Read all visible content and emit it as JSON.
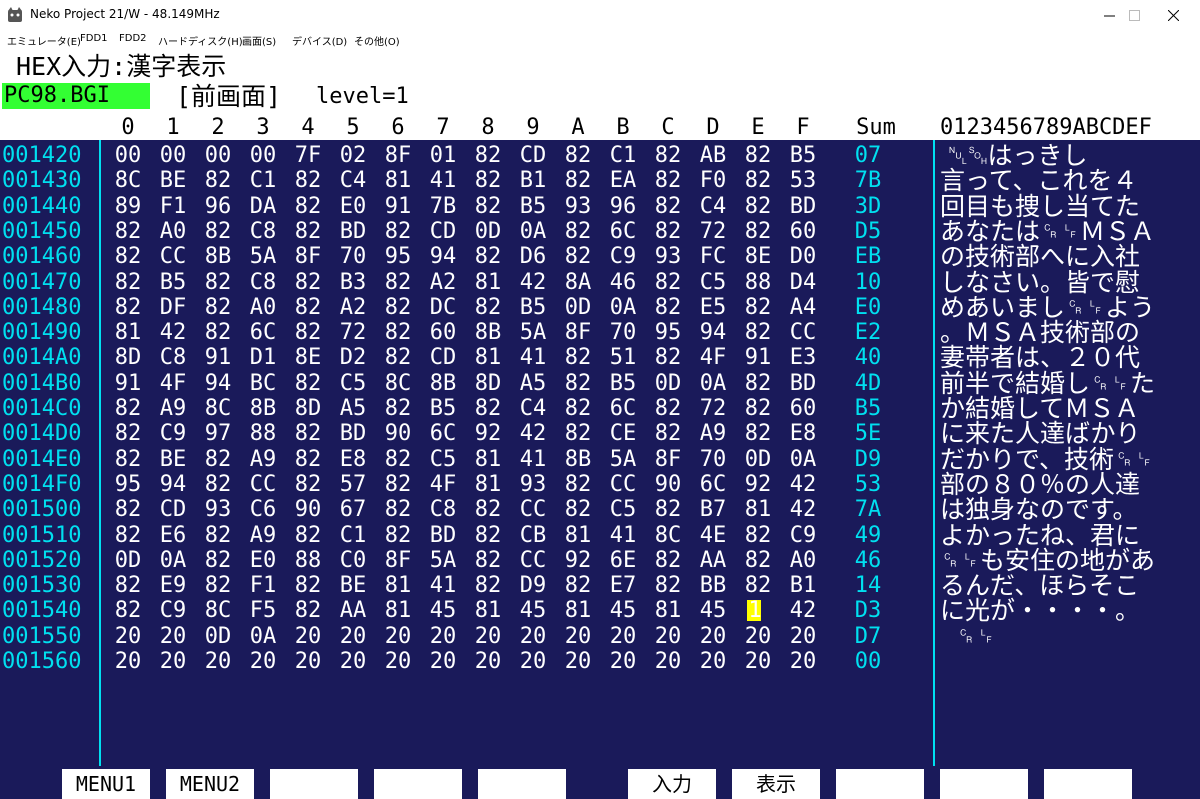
{
  "window": {
    "title": "Neko Project 21/W - 48.149MHz",
    "minimize_icon": "minimize-icon",
    "maximize_icon": "maximize-icon",
    "close_icon": "close-icon"
  },
  "menu": [
    "エミュレータ(E)",
    "FDD1",
    "FDD2",
    "ハードディスク(H)",
    "画面(S)",
    "デバイス(D)",
    "その他(O)"
  ],
  "header": {
    "mode_line": "HEX入力:漢字表示",
    "filename": "PC98.BGI",
    "display_mode": "[前画面]",
    "level": "level=1"
  },
  "columns": {
    "hex": [
      "0",
      "1",
      "2",
      "3",
      "4",
      "5",
      "6",
      "7",
      "8",
      "9",
      "A",
      "B",
      "C",
      "D",
      "E",
      "F"
    ],
    "sum_label": "Sum",
    "text_label": "0123456789ABCDEF"
  },
  "rows": [
    {
      "addr": "001420",
      "bytes": [
        "00",
        "00",
        "00",
        "00",
        "7F",
        "02",
        "8F",
        "01",
        "82",
        "CD",
        "82",
        "C1",
        "82",
        "AB",
        "82",
        "B5"
      ],
      "sum": "07"
    },
    {
      "addr": "001430",
      "bytes": [
        "8C",
        "BE",
        "82",
        "C1",
        "82",
        "C4",
        "81",
        "41",
        "82",
        "B1",
        "82",
        "EA",
        "82",
        "F0",
        "82",
        "53"
      ],
      "sum": "7B"
    },
    {
      "addr": "001440",
      "bytes": [
        "89",
        "F1",
        "96",
        "DA",
        "82",
        "E0",
        "91",
        "7B",
        "82",
        "B5",
        "93",
        "96",
        "82",
        "C4",
        "82",
        "BD"
      ],
      "sum": "3D"
    },
    {
      "addr": "001450",
      "bytes": [
        "82",
        "A0",
        "82",
        "C8",
        "82",
        "BD",
        "82",
        "CD",
        "0D",
        "0A",
        "82",
        "6C",
        "82",
        "72",
        "82",
        "60"
      ],
      "sum": "D5"
    },
    {
      "addr": "001460",
      "bytes": [
        "82",
        "CC",
        "8B",
        "5A",
        "8F",
        "70",
        "95",
        "94",
        "82",
        "D6",
        "82",
        "C9",
        "93",
        "FC",
        "8E",
        "D0"
      ],
      "sum": "EB"
    },
    {
      "addr": "001470",
      "bytes": [
        "82",
        "B5",
        "82",
        "C8",
        "82",
        "B3",
        "82",
        "A2",
        "81",
        "42",
        "8A",
        "46",
        "82",
        "C5",
        "88",
        "D4"
      ],
      "sum": "10"
    },
    {
      "addr": "001480",
      "bytes": [
        "82",
        "DF",
        "82",
        "A0",
        "82",
        "A2",
        "82",
        "DC",
        "82",
        "B5",
        "0D",
        "0A",
        "82",
        "E5",
        "82",
        "A4"
      ],
      "sum": "E0"
    },
    {
      "addr": "001490",
      "bytes": [
        "81",
        "42",
        "82",
        "6C",
        "82",
        "72",
        "82",
        "60",
        "8B",
        "5A",
        "8F",
        "70",
        "95",
        "94",
        "82",
        "CC"
      ],
      "sum": "E2"
    },
    {
      "addr": "0014A0",
      "bytes": [
        "8D",
        "C8",
        "91",
        "D1",
        "8E",
        "D2",
        "82",
        "CD",
        "81",
        "41",
        "82",
        "51",
        "82",
        "4F",
        "91",
        "E3"
      ],
      "sum": "40"
    },
    {
      "addr": "0014B0",
      "bytes": [
        "91",
        "4F",
        "94",
        "BC",
        "82",
        "C5",
        "8C",
        "8B",
        "8D",
        "A5",
        "82",
        "B5",
        "0D",
        "0A",
        "82",
        "BD"
      ],
      "sum": "4D"
    },
    {
      "addr": "0014C0",
      "bytes": [
        "82",
        "A9",
        "8C",
        "8B",
        "8D",
        "A5",
        "82",
        "B5",
        "82",
        "C4",
        "82",
        "6C",
        "82",
        "72",
        "82",
        "60"
      ],
      "sum": "B5"
    },
    {
      "addr": "0014D0",
      "bytes": [
        "82",
        "C9",
        "97",
        "88",
        "82",
        "BD",
        "90",
        "6C",
        "92",
        "42",
        "82",
        "CE",
        "82",
        "A9",
        "82",
        "E8"
      ],
      "sum": "5E"
    },
    {
      "addr": "0014E0",
      "bytes": [
        "82",
        "BE",
        "82",
        "A9",
        "82",
        "E8",
        "82",
        "C5",
        "81",
        "41",
        "8B",
        "5A",
        "8F",
        "70",
        "0D",
        "0A"
      ],
      "sum": "D9"
    },
    {
      "addr": "0014F0",
      "bytes": [
        "95",
        "94",
        "82",
        "CC",
        "82",
        "57",
        "82",
        "4F",
        "81",
        "93",
        "82",
        "CC",
        "90",
        "6C",
        "92",
        "42"
      ],
      "sum": "53"
    },
    {
      "addr": "001500",
      "bytes": [
        "82",
        "CD",
        "93",
        "C6",
        "90",
        "67",
        "82",
        "C8",
        "82",
        "CC",
        "82",
        "C5",
        "82",
        "B7",
        "81",
        "42"
      ],
      "sum": "7A"
    },
    {
      "addr": "001510",
      "bytes": [
        "82",
        "E6",
        "82",
        "A9",
        "82",
        "C1",
        "82",
        "BD",
        "82",
        "CB",
        "81",
        "41",
        "8C",
        "4E",
        "82",
        "C9"
      ],
      "sum": "49"
    },
    {
      "addr": "001520",
      "bytes": [
        "0D",
        "0A",
        "82",
        "E0",
        "88",
        "C0",
        "8F",
        "5A",
        "82",
        "CC",
        "92",
        "6E",
        "82",
        "AA",
        "82",
        "A0"
      ],
      "sum": "46"
    },
    {
      "addr": "001530",
      "bytes": [
        "82",
        "E9",
        "82",
        "F1",
        "82",
        "BE",
        "81",
        "41",
        "82",
        "D9",
        "82",
        "E7",
        "82",
        "BB",
        "82",
        "B1"
      ],
      "sum": "14"
    },
    {
      "addr": "001540",
      "bytes": [
        "82",
        "C9",
        "8C",
        "F5",
        "82",
        "AA",
        "81",
        "45",
        "81",
        "45",
        "81",
        "45",
        "81",
        "45",
        "",
        "1",
        "42"
      ],
      "sum": "D3"
    },
    {
      "addr": "001550",
      "bytes": [
        "20",
        "20",
        "0D",
        "0A",
        "20",
        "20",
        "20",
        "20",
        "20",
        "20",
        "20",
        "20",
        "20",
        "20",
        "20",
        "20"
      ],
      "sum": "D7"
    },
    {
      "addr": "001560",
      "bytes": [
        "20",
        "20",
        "20",
        "20",
        "20",
        "20",
        "20",
        "20",
        "20",
        "20",
        "20",
        "20",
        "20",
        "20",
        "20",
        "20"
      ],
      "sum": "00"
    }
  ],
  "text_lines": [
    " ␀␁はっきし",
    "言って、これを４",
    "回目も捜し当てた",
    "あなたは␍␊ＭＳＡ",
    "の技術部へに入社",
    "しなさい。皆で慰",
    "めあいまし␍␊よう",
    "。ＭＳＡ技術部の",
    "妻帯者は、２０代",
    "前半で結婚し␍␊た",
    "か結婚してＭＳＡ",
    "に来た人達ばかり",
    "だかりで、技術␍␊",
    "部の８０％の人達",
    "は独身なのです。",
    "よかったね、君に",
    "␍␊も安住の地があ",
    "るんだ、ほらそこ",
    "に光が・・・・。",
    "  ␍␊",
    ""
  ],
  "cursor_row": 18,
  "fkeys": [
    "MENU1",
    "MENU2",
    "",
    "",
    "",
    "入力",
    "表示",
    "",
    "",
    ""
  ],
  "colors": {
    "background": "#1a1a5a",
    "address": "#00e0f0",
    "bytes": "#ffffff",
    "filename_bg": "#33ff33",
    "cursor": "#ffff00"
  }
}
